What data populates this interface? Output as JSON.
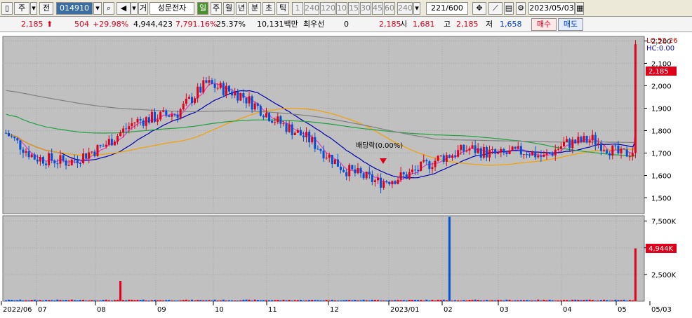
{
  "toolbar": {
    "market": "주",
    "type": "전",
    "code": "014910",
    "name_prefix": "거",
    "name": "성문전자",
    "period_active": "일",
    "periods": [
      "주",
      "월",
      "년",
      "분",
      "초",
      "틱"
    ],
    "minutes": [
      "1",
      "240",
      "120",
      "10",
      "15",
      "30",
      "45",
      "60",
      "240"
    ],
    "count": "221/600",
    "date": "2023/05/03"
  },
  "quote": {
    "price": "2,185",
    "change": "504",
    "change_pct": "+29.98%",
    "volume": "4,944,423",
    "volume_pct": "7,791.16%",
    "turnover": "25.37%",
    "amount": "10,131백만",
    "name": "최우선",
    "zero": "0",
    "current": "2,185",
    "open_label": "시",
    "open": "1,681",
    "high_label": "고",
    "high": "2,185",
    "low_label": "저",
    "low": "1,658",
    "buy": "매수",
    "sell": "매도"
  },
  "chart_data": {
    "type": "candlestick",
    "price_axis": {
      "ticks": [
        "2,200",
        "2,100",
        "2,000",
        "1,900",
        "1,800",
        "1,700",
        "1,600",
        "1,500"
      ],
      "ylim": [
        1430,
        2220
      ]
    },
    "volume_axis": {
      "ticks": [
        "7,500K",
        "5,000K",
        "2,500K"
      ],
      "ylim": [
        0,
        8000
      ]
    },
    "lc_label": "LC:52.26",
    "hc_label": "HC:0.00",
    "last_price_label": "2,185",
    "last_volume_label": "4,944K",
    "annotation": "배당락(0.00%)",
    "x_labels": [
      "2022/06",
      "07",
      "08",
      "09",
      "10",
      "11",
      "12",
      "2023/01",
      "02",
      "03",
      "04",
      "05",
      "05/03"
    ],
    "colors": {
      "up": "#e0001a",
      "down": "#0050d8",
      "ma5": "#e040c0",
      "ma20": "#0000b0",
      "ma60": "#f5a000",
      "ma120": "#20a040",
      "ma240": "#808080"
    }
  }
}
